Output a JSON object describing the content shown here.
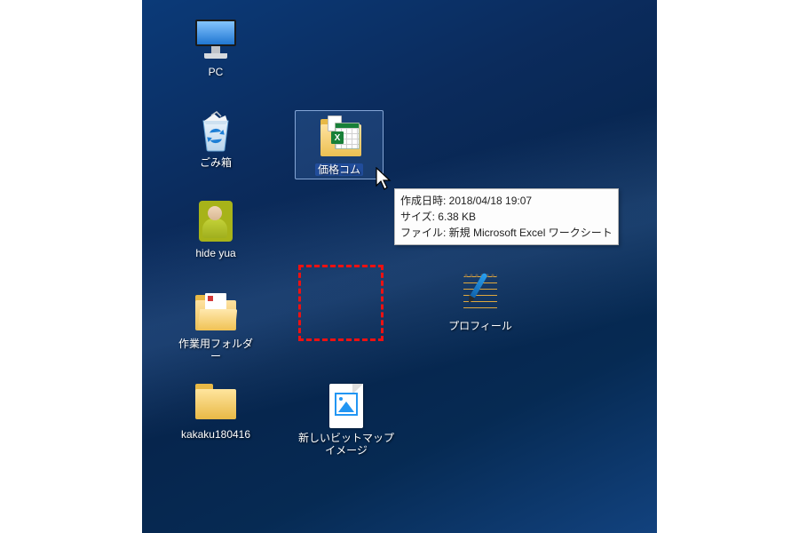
{
  "icons": {
    "pc": {
      "label": "PC"
    },
    "recycle": {
      "label": "ごみ箱"
    },
    "user": {
      "label": "hide yua"
    },
    "work_folder": {
      "label": "作業用フォルダー"
    },
    "kakaku_folder": {
      "label": "kakaku180416"
    },
    "price_folder": {
      "label": "価格コム"
    },
    "bitmap": {
      "label": "新しいビットマップ イメージ"
    },
    "profile": {
      "label": "プロフィール"
    }
  },
  "tooltip": {
    "line1": "作成日時: 2018/04/18 19:07",
    "line2": "サイズ: 6.38 KB",
    "line3": "ファイル: 新規 Microsoft Excel ワークシート"
  },
  "folder_xls_badge": "X"
}
